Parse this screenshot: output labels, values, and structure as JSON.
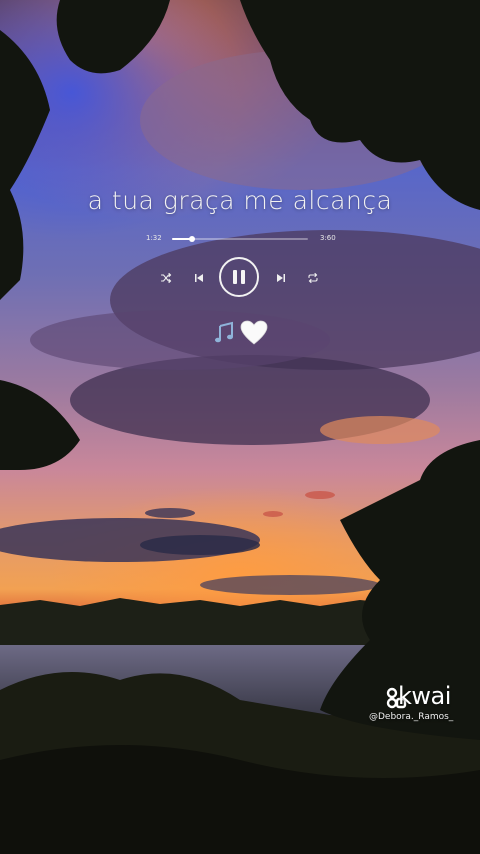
{
  "player": {
    "song_title": "a tua graça me alcança",
    "time_elapsed": "1:32",
    "time_total": "3:60",
    "progress_fraction": 0.15,
    "controls": {
      "shuffle_icon": "shuffle-icon",
      "prev_icon": "skip-previous-icon",
      "pause_icon": "pause-icon",
      "next_icon": "skip-next-icon",
      "repeat_icon": "repeat-icon"
    },
    "emojis": [
      "musical-notes-emoji",
      "white-heart-emoji"
    ]
  },
  "watermark": {
    "brand": "kwai",
    "username": "@Debora._Ramos_"
  },
  "colors": {
    "sky_blue": "#4d5fd0",
    "sunset_orange": "#e9783c",
    "cloud_purple": "#4c3a5e",
    "text_white": "#f2f2f2"
  }
}
